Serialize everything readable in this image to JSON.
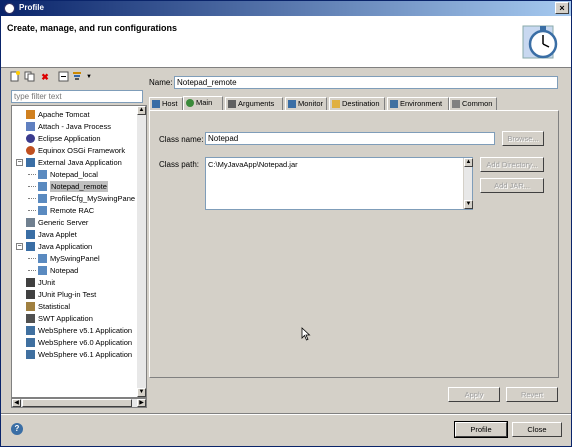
{
  "window": {
    "title": "Profile"
  },
  "banner": {
    "heading": "Create, manage, and run configurations",
    "icon": "stopwatch-icon"
  },
  "left_toolbar": {
    "icons": [
      "new-config-icon",
      "duplicate-icon",
      "delete-icon",
      "collapse-all-icon",
      "filter-icon",
      "dropdown-icon"
    ]
  },
  "filter": {
    "placeholder": "type filter text"
  },
  "tree": {
    "items": [
      {
        "label": "Apache Tomcat",
        "icon": "tomcat-icon"
      },
      {
        "label": "Attach - Java Process",
        "icon": "attach-icon"
      },
      {
        "label": "Eclipse Application",
        "icon": "eclipse-icon"
      },
      {
        "label": "Equinox OSGi Framework",
        "icon": "osgi-icon"
      },
      {
        "label": "External Java Application",
        "icon": "java-app-icon",
        "expanded": true
      },
      {
        "label": "Notepad_local",
        "icon": "config-icon"
      },
      {
        "label": "Notepad_remote",
        "icon": "config-icon",
        "selected": true
      },
      {
        "label": "ProfileCfg_MySwingPane",
        "icon": "config-icon"
      },
      {
        "label": "Remote RAC",
        "icon": "config-icon"
      },
      {
        "label": "Generic Server",
        "icon": "server-icon"
      },
      {
        "label": "Java Applet",
        "icon": "applet-icon"
      },
      {
        "label": "Java Application",
        "icon": "java-app-icon",
        "expanded": true
      },
      {
        "label": "MySwingPanel",
        "icon": "config-icon"
      },
      {
        "label": "Notepad",
        "icon": "config-icon"
      },
      {
        "label": "JUnit",
        "icon": "junit-icon"
      },
      {
        "label": "JUnit Plug-in Test",
        "icon": "junit-icon"
      },
      {
        "label": "Statistical",
        "icon": "stats-icon"
      },
      {
        "label": "SWT Application",
        "icon": "swt-icon"
      },
      {
        "label": "WebSphere v5.1 Application",
        "icon": "websphere-icon"
      },
      {
        "label": "WebSphere v6.0 Application",
        "icon": "websphere-icon"
      },
      {
        "label": "WebSphere v6.1 Application",
        "icon": "websphere-icon"
      }
    ]
  },
  "config": {
    "name_label": "Name:",
    "name_value": "Notepad_remote",
    "tabs": [
      {
        "label": "Host",
        "icon": "host-icon"
      },
      {
        "label": "Main",
        "icon": "main-icon",
        "active": true
      },
      {
        "label": "Arguments",
        "icon": "arguments-icon"
      },
      {
        "label": "Monitor",
        "icon": "monitor-icon"
      },
      {
        "label": "Destination",
        "icon": "folder-icon"
      },
      {
        "label": "Environment",
        "icon": "environment-icon"
      },
      {
        "label": "Common",
        "icon": "common-icon"
      }
    ],
    "class_name_label": "Class name:",
    "class_name_value": "Notepad",
    "browse_label": "Browse...",
    "class_path_label": "Class path:",
    "class_path_value": "C:\\MyJavaApp\\Notepad.jar",
    "add_directory_label": "Add Directory...",
    "add_jar_label": "Add JAR...",
    "apply_label": "Apply",
    "revert_label": "Revert"
  },
  "footer": {
    "profile_label": "Profile",
    "close_label": "Close",
    "help_icon": "help-icon"
  },
  "colors": {
    "title_start": "#0a246a",
    "title_end": "#a6caf0",
    "face": "#d4d0c8"
  }
}
